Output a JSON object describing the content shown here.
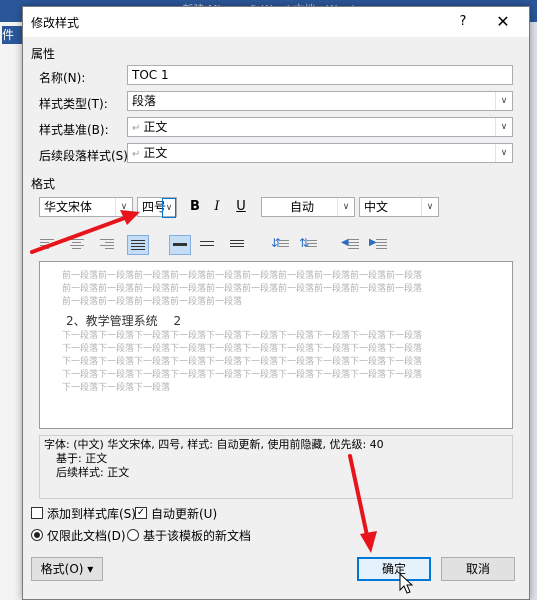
{
  "background": {
    "window_title": "新建 Microsoft Word 文档 - Word",
    "ribbon_tab": "件"
  },
  "dialog": {
    "title": "修改样式",
    "help": "?",
    "close": "✕",
    "properties": {
      "section_label": "属性",
      "name_label": "名称(N):",
      "name_value": "TOC 1",
      "style_type_label": "样式类型(T):",
      "style_type_value": "段落",
      "based_on_label": "样式基准(B):",
      "based_on_value": "正文",
      "following_label": "后续段落样式(S):",
      "following_value": "正文"
    },
    "format": {
      "section_label": "格式",
      "font_value": "华文宋体",
      "size_value": "四号",
      "bold": "B",
      "italic": "I",
      "underline": "U",
      "color_value": "自动",
      "script_value": "中文"
    },
    "preview": {
      "prev_line1": "前一段落前一段落前一段落前一段落前一段落前一段落前一段落前一段落前一段落前一段落",
      "prev_line2": "前一段落前一段落前一段落前一段落前一段落前一段落前一段落前一段落前一段落前一段落",
      "prev_line3": "前一段落前一段落前一段落前一段落前一段落",
      "sample": "2、教学管理系统　 2",
      "next_line1": "下一段落下一段落下一段落下一段落下一段落下一段落下一段落下一段落下一段落下一段落",
      "next_line2": "下一段落下一段落下一段落下一段落下一段落下一段落下一段落下一段落下一段落下一段落",
      "next_line3": "下一段落下一段落下一段落下一段落下一段落下一段落下一段落下一段落下一段落下一段落",
      "next_line4": "下一段落下一段落下一段落下一段落下一段落下一段落下一段落下一段落下一段落下一段落",
      "next_line5": "下一段落下一段落下一段落"
    },
    "description": {
      "line1": "字体: (中文) 华文宋体, 四号, 样式: 自动更新, 使用前隐藏, 优先级: 40",
      "line2": "基于: 正文",
      "line3": "后续样式: 正文"
    },
    "options": {
      "add_to_gallery": "添加到样式库(S)",
      "add_to_gallery_checked": false,
      "auto_update": "自动更新(U)",
      "auto_update_checked": true,
      "only_this_doc": "仅限此文档(D)",
      "new_docs_template": "基于该模板的新文档"
    },
    "buttons": {
      "format": "格式(O) ▾",
      "ok": "确定",
      "cancel": "取消"
    }
  },
  "colors": {
    "accent": "#0078d7",
    "annotation_arrow": "#e8141b",
    "title_bar": "#2b579a"
  }
}
